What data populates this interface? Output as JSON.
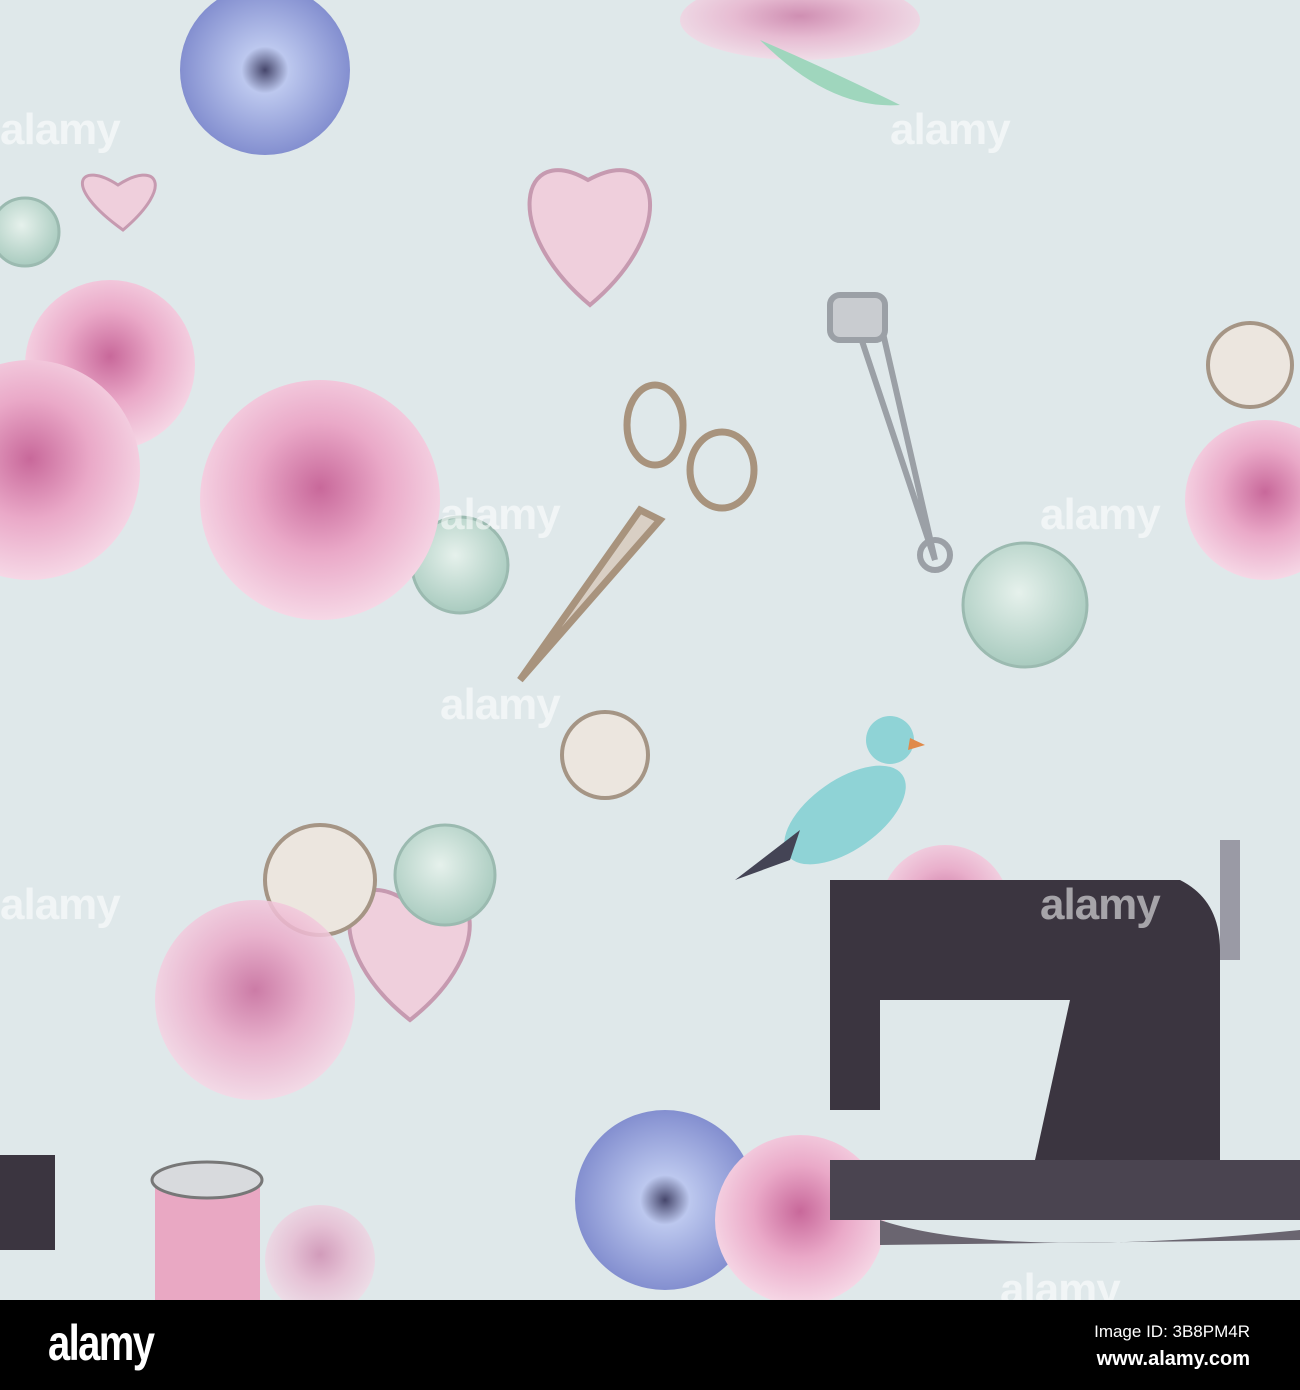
{
  "watermark": "alamy",
  "footer": {
    "logo": "alamy",
    "image_id": "Image ID: 3B8PM4R",
    "url": "www.alamy.com"
  },
  "colors": {
    "background": "#dfe8ea",
    "peony": "#e9a9c6",
    "button_mint": "#cfe3dc",
    "heart": "#efcfdc",
    "machine": "#3b3540",
    "bird": "#8fd3d6"
  }
}
